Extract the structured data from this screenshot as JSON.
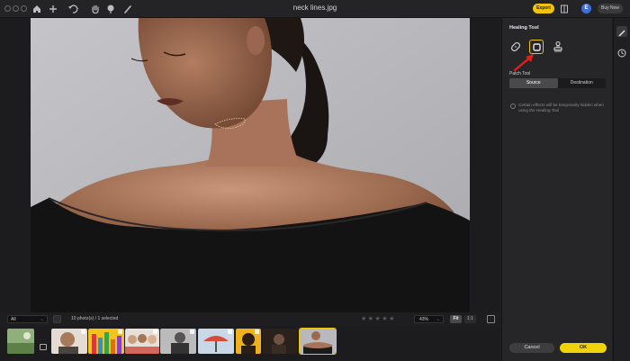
{
  "window": {
    "title": "neck lines.jpg"
  },
  "toolbar": {
    "export_label": "Export",
    "avatar_initial": "E",
    "buy_label": "Buy Now",
    "icons": [
      "home-icon",
      "add-icon",
      "undo-icon",
      "hand-icon",
      "mask-icon",
      "brush-icon",
      "compare-icon"
    ]
  },
  "panel": {
    "title": "Healing Tool",
    "tools": [
      {
        "icon": "bandage-icon",
        "active": false
      },
      {
        "icon": "patch-icon",
        "active": true
      },
      {
        "icon": "clone-stamp-icon",
        "active": false
      }
    ],
    "patch_label": "Patch Tool",
    "segments": {
      "source": "Source",
      "destination": "Destination",
      "selected": "Source"
    },
    "note": "Certain effects will be temporarily hidden when using the Healing Tool",
    "cancel_label": "Cancel",
    "ok_label": "OK"
  },
  "filmstrip": {
    "filter_value": "All",
    "photo_count": "10 photo(s) / 1 selected",
    "rating_stars": "★★★★★",
    "zoom_value": "43%",
    "fit_label": "Fit",
    "one_to_one_label": "1:1",
    "thumbnails": [
      {
        "name": "thumb-landscape",
        "colors": [
          "#6d8f5a",
          "#9cbf84"
        ]
      },
      {
        "name": "thumb-man-laughing",
        "colors": [
          "#a77a5c",
          "#e8d9cc"
        ]
      },
      {
        "name": "thumb-colorful-pencils",
        "colors": [
          "#f3c21c",
          "#d63a3a"
        ]
      },
      {
        "name": "thumb-group-photo",
        "colors": [
          "#c9a07e",
          "#e6e0d8"
        ]
      },
      {
        "name": "thumb-bw-portrait",
        "colors": [
          "#444444",
          "#bbbbbb"
        ]
      },
      {
        "name": "thumb-umbrella",
        "colors": [
          "#c8d8e6",
          "#d84a3a"
        ]
      },
      {
        "name": "thumb-yellow-portrait",
        "colors": [
          "#f0b21c",
          "#2b1e14"
        ]
      },
      {
        "name": "thumb-dark-portrait",
        "colors": [
          "#2a211c",
          "#6f5242"
        ]
      },
      {
        "name": "thumb-neck-lines",
        "colors": [
          "#b8b8bd",
          "#2a2a2a"
        ],
        "selected": true
      }
    ]
  },
  "colors": {
    "accent": "#f2c409",
    "ok": "#f2d30a",
    "arrow": "#e0201b"
  }
}
